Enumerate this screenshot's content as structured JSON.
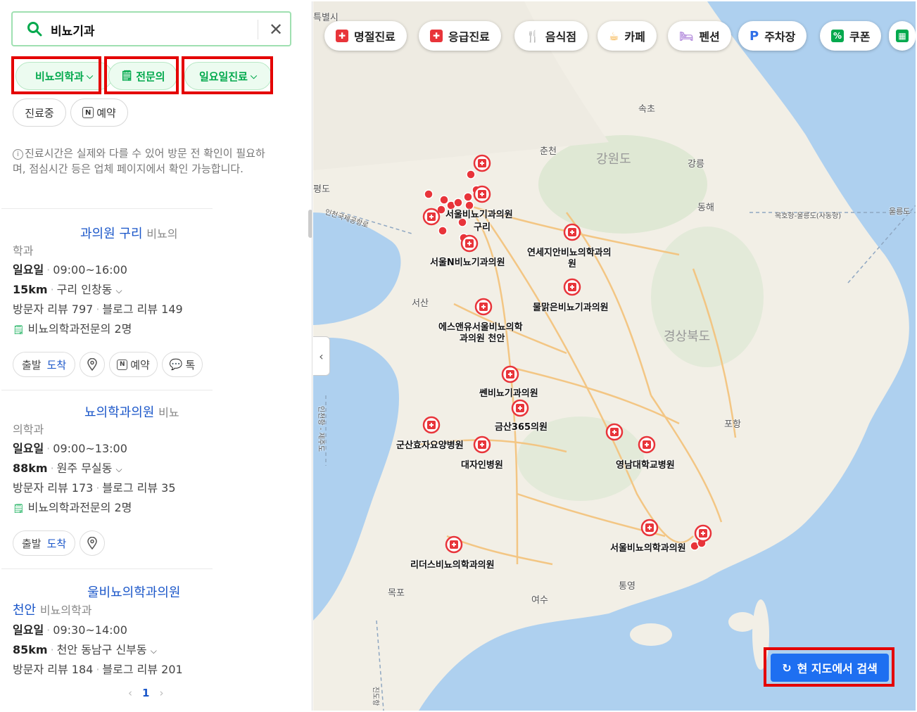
{
  "search": {
    "query": "비뇨기과"
  },
  "filters": {
    "row1": [
      {
        "label": "비뇨의학과"
      },
      {
        "label": "전문의"
      },
      {
        "label": "일요일진료"
      }
    ],
    "row2": [
      {
        "label": "진료중"
      },
      {
        "label": "예약"
      }
    ]
  },
  "notice": "진료시간은 실제와 다를 수 있어 방문 전 확인이 필요하며, 점심시간 등은 업체 페이지에서 확인 가능합니다.",
  "results": [
    {
      "title_a": "과의원 구리",
      "title_b": "비뇨의",
      "title_c": "학과",
      "day": "일요일",
      "hours": "09:00~16:00",
      "distance": "15km",
      "address": "구리 인창동",
      "visitor_reviews": "방문자 리뷰 797",
      "blog_reviews": "블로그 리뷰 149",
      "specialists": "비뇨의학과전문의 2명",
      "buttons": {
        "start": "출발",
        "arrive": "도착",
        "reserve": "예약",
        "talk": "톡"
      }
    },
    {
      "title_a": "뇨의학과의원",
      "title_b": "비뇨",
      "title_c": "의학과",
      "day": "일요일",
      "hours": "09:00~13:00",
      "distance": "88km",
      "address": "원주 무실동",
      "visitor_reviews": "방문자 리뷰 173",
      "blog_reviews": "블로그 리뷰 35",
      "specialists": "비뇨의학과전문의 2명",
      "buttons": {
        "start": "출발",
        "arrive": "도착"
      }
    },
    {
      "title_a": "울비뇨의학과의원",
      "title_b": "천안",
      "title_c": "비뇨의학과",
      "day": "일요일",
      "hours": "09:30~14:00",
      "distance": "85km",
      "address": "천안 동남구 신부동",
      "visitor_reviews": "방문자 리뷰 184",
      "blog_reviews": "블로그 리뷰 201"
    }
  ],
  "pager": {
    "prev": "‹",
    "current": "1",
    "next": "›"
  },
  "map": {
    "categories": [
      "명절진료",
      "응급진료",
      "음식점",
      "카페",
      "펜션",
      "주차장",
      "쿠폰"
    ],
    "place_labels": {
      "seoul": "서울비뇨기과의원",
      "guri": "구리",
      "seouln": "서울N비뇨기과의원",
      "yonsei_a": "연세지안비뇨의학과의",
      "yonsei_b": "원",
      "mulmalgeun": "물맑은비뇨기과의원",
      "esnyu_a": "에스앤유서울비뇨의학",
      "esnyu_b": "과의원 천안",
      "ssen": "쎈비뇨기과의원",
      "geumsan": "금산365의원",
      "gunsan": "군산효자요양병원",
      "daeja": "대자인병원",
      "yeungnam": "영남대학교병원",
      "seoulbusan": "서울비뇨의학과의원",
      "liders": "리더스비뇨의학과의원"
    },
    "geo_labels": {
      "teukbyeol": "특별시",
      "sokcho": "속초",
      "chuncheon": "춘천",
      "gangneung": "강릉",
      "donghae": "동해",
      "pyeongdo": "평도",
      "seosan": "서산",
      "pohang": "포항",
      "mokpo": "목포",
      "yeosu": "여수",
      "tongyeong": "통영",
      "road1": "인천국제공항로",
      "road2": "목호항-울릉도(사동항)",
      "road3": "울릉도",
      "road4": "인천항 - 제주도",
      "road5": "진도항"
    },
    "region_labels": {
      "gangwon": "강원도",
      "gyeongbuk": "경상북도"
    },
    "search_here": "현 지도에서 검색"
  },
  "colors": {
    "accent_green": "#03a94d",
    "link_blue": "#1a56c9",
    "highlight_red": "#e40000",
    "map_button_blue": "#1e6ff1",
    "marker_red": "#e8343a"
  }
}
